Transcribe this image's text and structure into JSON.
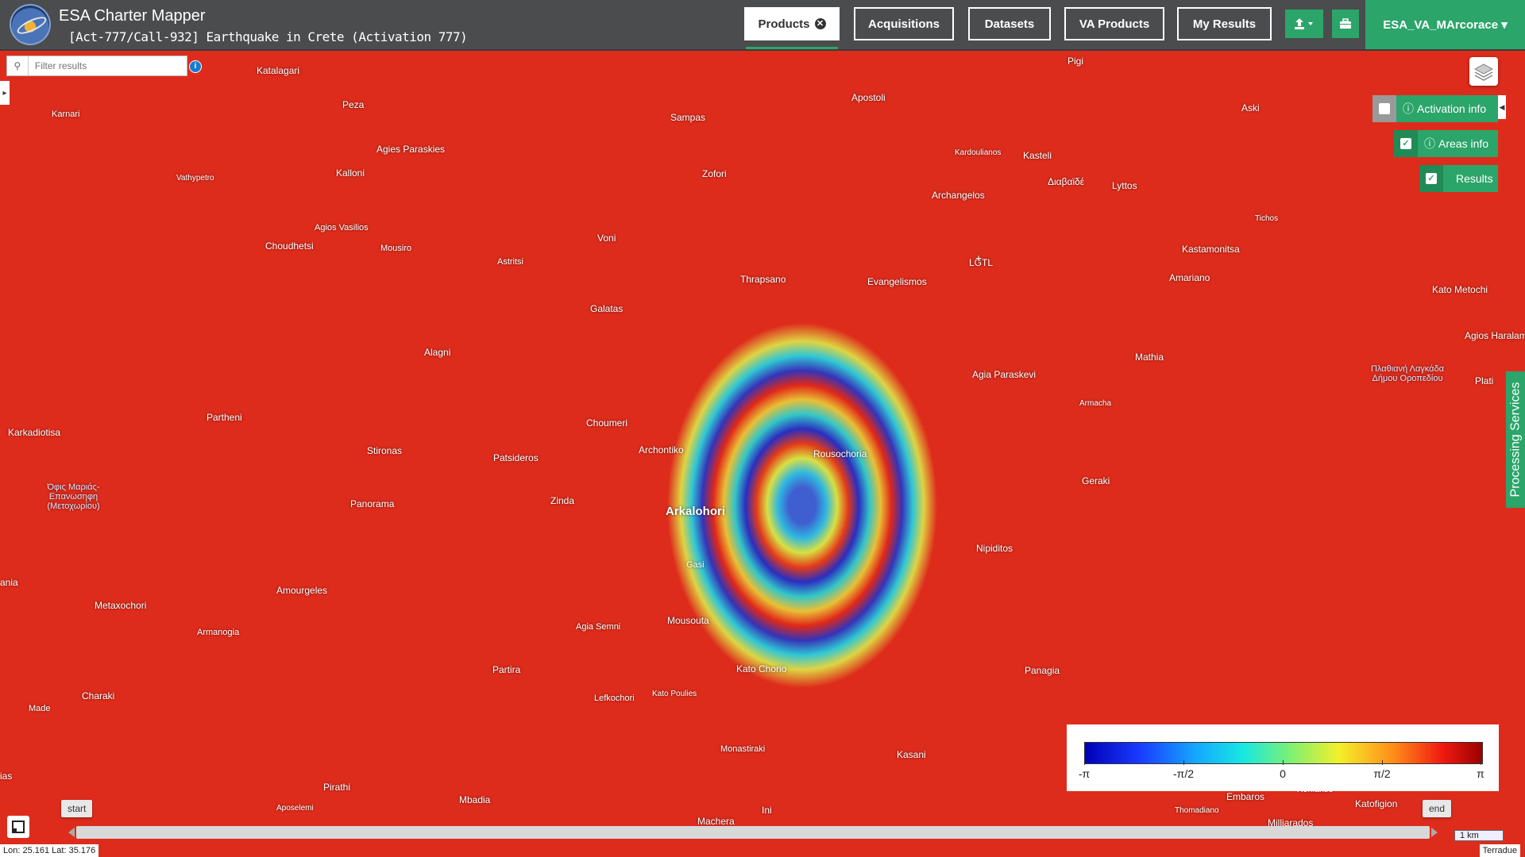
{
  "header": {
    "app_title": "ESA Charter Mapper",
    "activation_title": "[Act-777/Call-932] Earthquake in Crete (Activation 777)",
    "nav": {
      "products": "Products",
      "acquisitions": "Acquisitions",
      "datasets": "Datasets",
      "va_products": "VA Products",
      "my_results": "My Results"
    },
    "upload_icon": "upload-icon",
    "briefcase_icon": "briefcase-icon",
    "user": "ESA_VA_MArcorace ▾"
  },
  "filter": {
    "placeholder": "Filter results"
  },
  "panels": {
    "activation_info": "Activation info",
    "areas_info": "Areas info",
    "results": "Results"
  },
  "processing_services": "Processing Services",
  "legend": {
    "ticks": [
      "-π",
      "-π/2",
      "0",
      "π/2",
      "π"
    ]
  },
  "timeline": {
    "start": "start",
    "end": "end"
  },
  "scale": "1 km",
  "coords": "Lon: 25.161 Lat: 35.176",
  "attribution": "Terradue",
  "places": {
    "katalagari": "Katalagari",
    "karnari": "Karnari",
    "peza": "Peza",
    "agies": "Agies Paraskies",
    "kalloni": "Kalloni",
    "vathypetro": "Vathypetro",
    "choudhetsi": "Choudhetsi",
    "agios_vasilios": "Agios Vasilios",
    "mousiro": "Mousiro",
    "astritsi": "Astritsi",
    "sampas": "Sampas",
    "apostoli": "Apostoli",
    "pigi": "Pigi",
    "aski": "Aski",
    "kardoulianos": "Kardoulianos",
    "kasteli": "Kasteli",
    "diavaide": "Διαβαϊδέ",
    "lyttos": "Lyttos",
    "zofori": "Zofori",
    "archangelos": "Archangelos",
    "tichos": "Tichos",
    "voni": "Voni",
    "lgtl": "LGTL",
    "kastamonitsa": "Kastamonitsa",
    "thrapsano": "Thrapsano",
    "evangelismos": "Evangelismos",
    "amariano": "Amariano",
    "galatas": "Galatas",
    "kato_metochi": "Kato Metochi",
    "agios_haralampos": "Agios Haralam",
    "alagni": "Alagni",
    "agia_paraskevi": "Agia Paraskevi",
    "mathia": "Mathia",
    "plati": "Plati",
    "water_right": "Πλαθιανή Λαγκάδα Δήμου Οροπεδίου",
    "partheni": "Partheni",
    "armacha": "Armacha",
    "choumeri": "Choumeri",
    "karkadiotisa": "Karkadiotisa",
    "stironas": "Stironas",
    "archontiko": "Archontiko",
    "patsideros": "Patsideros",
    "rousochoria": "Rousochoria",
    "geraki": "Geraki",
    "water_left": "Όφις Μαριάς-Επανωσηφη (Μετοχωρίου)",
    "panorama": "Panorama",
    "zinda": "Zinda",
    "arkalohori": "Arkalohori",
    "nipiditos": "Nipiditos",
    "gasi": "Gasi",
    "ania": "ania",
    "amourgeles": "Amourgeles",
    "metaxochori": "Metaxochori",
    "agia_semni": "Agia Semni",
    "mousouta": "Mousouta",
    "armanogia": "Armanogia",
    "partira": "Partira",
    "kato_chorio": "Kato Chorio",
    "panagia": "Panagia",
    "charaki": "Charaki",
    "lefkochori": "Lefkochori",
    "kato_poulies": "Kato Poulies",
    "made": "Made",
    "monastiraki": "Monastiraki",
    "kasani": "Kasani",
    "ias": "ias",
    "pirathi": "Pirathi",
    "embaros": "Embaros",
    "xeniakos": "Xeniakos",
    "katofigion": "Katofigion",
    "aposelemi": "Aposelemi",
    "mbadia": "Mbadia",
    "ini": "Ini",
    "thomadiano": "Thomadiano",
    "machera": "Machera",
    "milliarados": "Milliarados"
  }
}
